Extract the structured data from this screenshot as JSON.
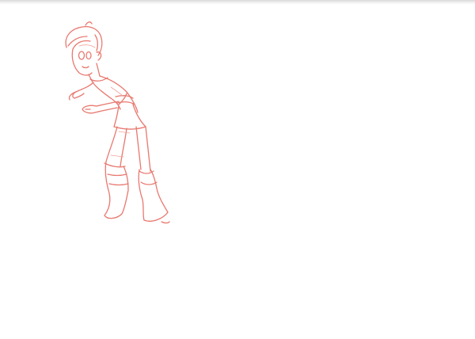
{
  "sheet": {
    "paper_color": "#ffffff",
    "edge_color": "#d9d9d9"
  },
  "sketch": {
    "subject": "character-sketch",
    "pencil_color": "#e8786f",
    "light_pencil_color": "#f0a39c"
  }
}
